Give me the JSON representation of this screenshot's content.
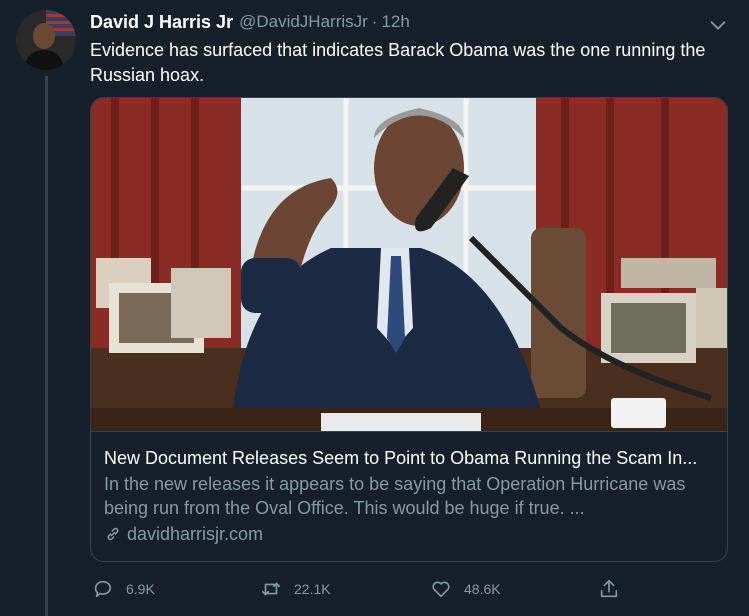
{
  "tweet": {
    "display_name": "David J Harris Jr",
    "handle": "@DavidJHarrisJr",
    "separator": "·",
    "time": "12h",
    "text": "Evidence has surfaced that indicates Barack Obama was the one running the Russian hoax."
  },
  "card": {
    "title": "New Document Releases Seem to Point to Obama Running the Scam In...",
    "description": "In the new releases it appears to be saying that Operation Hurricane was being run from the Oval Office. This would be huge if true. ...",
    "domain": "davidharrisjr.com"
  },
  "actions": {
    "replies": "6.9K",
    "retweets": "22.1K",
    "likes": "48.6K"
  },
  "icons": {
    "more": "chevron-down-icon",
    "reply": "reply-icon",
    "retweet": "retweet-icon",
    "like": "heart-icon",
    "share": "share-icon",
    "link": "link-icon"
  },
  "colors": {
    "background": "#15202b",
    "border": "#38444d",
    "secondary_text": "#8899a6",
    "primary_text": "#ffffff"
  }
}
